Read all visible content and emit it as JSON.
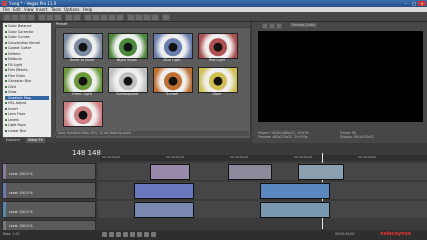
{
  "app": {
    "title": "Y.veg * - Vegas Pro 11.0",
    "window_buttons": [
      "–",
      "□",
      "×"
    ]
  },
  "menu": [
    "File",
    "Edit",
    "View",
    "Insert",
    "Tools",
    "Options",
    "Help"
  ],
  "effects_tree": {
    "items": [
      "Color Balance",
      "Color Corrector",
      "Color Curves",
      "Convolution Kernel",
      "Cookie Cutter",
      "Deform",
      "Defocus",
      "Fill Light",
      "Film Effects",
      "Film Grain",
      "Gaussian Blur",
      "Glint",
      "Glow",
      "Gradient Map",
      "HSL Adjust",
      "Invert",
      "Lens Flare",
      "Levels",
      "Light Rays",
      "Linear Blur"
    ],
    "selected": "Gradient Map"
  },
  "presets": {
    "header": "Preset",
    "items": [
      "Reset to None",
      "Night Vision",
      "Blue Light",
      "Red Light",
      "Green Light",
      "Overexposed",
      "Sunset",
      "Glare",
      ""
    ],
    "colors": [
      "#7a8aa0",
      "#4c8a3a",
      "#6a7fb0",
      "#b05050",
      "#6a9a3a",
      "#c0c0c0",
      "#c07030",
      "#d0c050",
      "#d08080"
    ],
    "status": "Sony Gradient Map: OFX, 32-bit floating point"
  },
  "panel_tabs": [
    "Explorer",
    "Video FX"
  ],
  "preview": {
    "dropdown": "Preview (Auto)",
    "project": "Project:  1920x1080x32, 29.970i",
    "preview": "Preview:  480x270x32, 29.970p",
    "frame_label": "Frame:  90",
    "display_label": "Display:  361x203x32"
  },
  "timeline": {
    "timecode": "148 148",
    "ruler_labels": [
      "00:00:00;00",
      "00:00:02;00",
      "00:00:04;00",
      "00:00:06;00",
      "00:00:08;00"
    ],
    "tracks": [
      {
        "level": "Level: 100.0 %",
        "color": "#8a7a9a"
      },
      {
        "level": "Level: 100.0 %",
        "color": "#6a7aaa"
      },
      {
        "level": "Level: 100.0 %",
        "color": "#5a8aaa"
      },
      {
        "level": "Level: 100.0 %",
        "color": "#7a7a7a"
      }
    ]
  },
  "transport": {
    "rate": "Rate: 1.00",
    "time_end": "00:00:03;00"
  },
  "watermark": "xxlaceyxox"
}
